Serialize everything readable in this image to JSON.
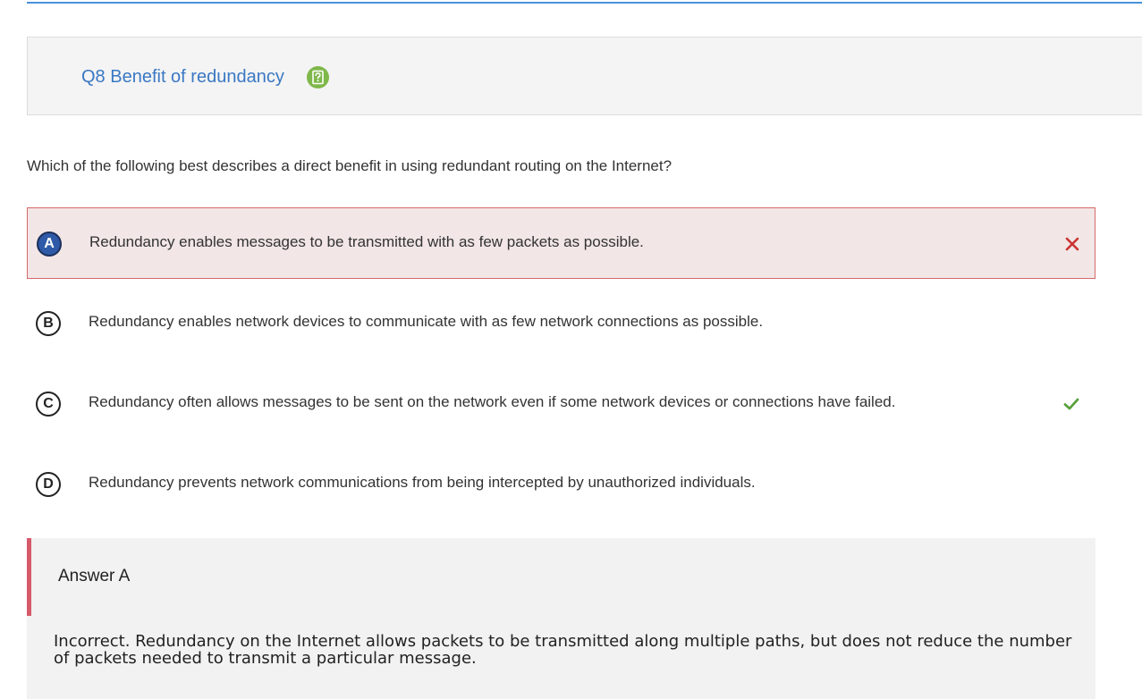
{
  "question": {
    "title": "Q8 Benefit of redundancy",
    "help_icon": "help-icon",
    "prompt": "Which of the following best describes a direct benefit in using redundant routing on the Internet?"
  },
  "choices": [
    {
      "letter": "A",
      "text": "Redundancy enables messages to be transmitted with as few packets as possible.",
      "selected": true,
      "status": "incorrect",
      "status_icon": "close-icon"
    },
    {
      "letter": "B",
      "text": "Redundancy enables network devices to communicate with as few network connections as possible.",
      "selected": false,
      "status": "",
      "status_icon": ""
    },
    {
      "letter": "C",
      "text": "Redundancy often allows messages to be sent on the network even if some network devices or connections have failed.",
      "selected": false,
      "status": "correct",
      "status_icon": "check-icon"
    },
    {
      "letter": "D",
      "text": "Redundancy prevents network communications from being intercepted by unauthorized individuals.",
      "selected": false,
      "status": "",
      "status_icon": ""
    }
  ],
  "feedback": {
    "title": "Answer A",
    "text": "Incorrect. Redundancy on the Internet allows packets to be transmitted along multiple paths, but does not reduce the number of packets needed to transmit a particular message."
  },
  "colors": {
    "accent_blue": "#3a78c3",
    "help_green": "#7fb84a",
    "incorrect_red": "#cc3333",
    "correct_green": "#5aa03c",
    "wrong_bg": "#f2e6e6",
    "feedback_bar": "#d65a6a"
  }
}
